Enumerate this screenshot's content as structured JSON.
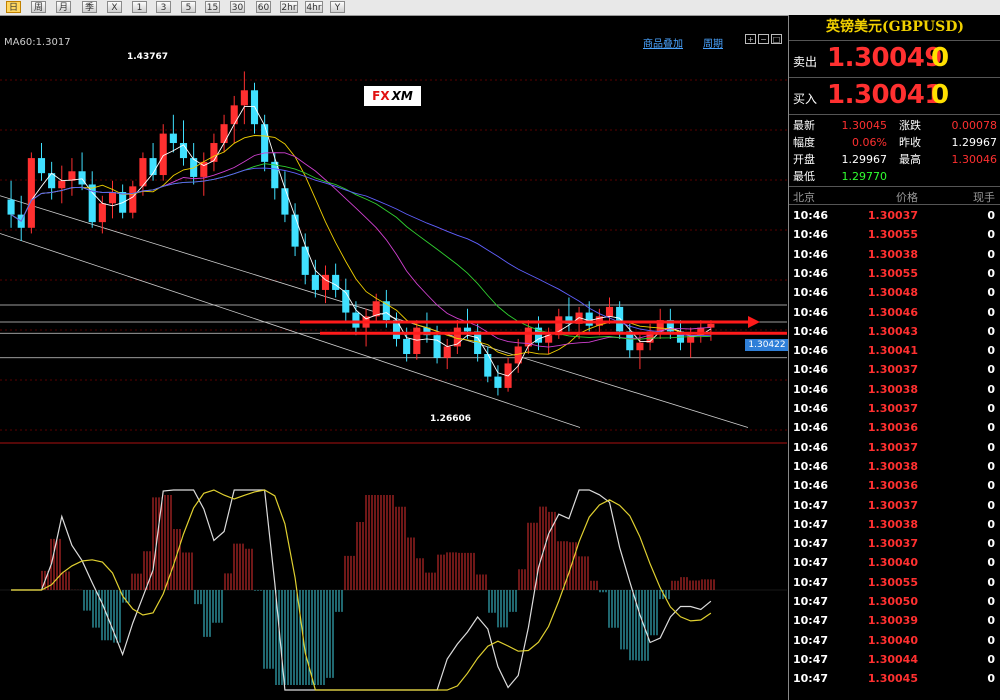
{
  "toolbar": {
    "buttons": [
      "日",
      "周",
      "月",
      "季",
      "X",
      "1",
      "3",
      "5",
      "15",
      "30",
      "60",
      "2hr",
      "4hr",
      "Y"
    ]
  },
  "chart_links": {
    "overlay": "商品叠加",
    "period": "周期"
  },
  "chart_data": {
    "type": "candlestick",
    "symbol": "GBPUSD",
    "ma_label": "MA60:1.3017",
    "high_annotation": "1.43767",
    "low_annotation": "1.26606",
    "current_price_tag": "1.30422",
    "price_range": [
      1.245,
      1.46
    ],
    "ohlc": [
      [
        1.37,
        1.38,
        1.355,
        1.362
      ],
      [
        1.362,
        1.372,
        1.348,
        1.355
      ],
      [
        1.355,
        1.395,
        1.352,
        1.392
      ],
      [
        1.392,
        1.4,
        1.38,
        1.384
      ],
      [
        1.384,
        1.39,
        1.37,
        1.376
      ],
      [
        1.376,
        1.388,
        1.368,
        1.38
      ],
      [
        1.38,
        1.392,
        1.372,
        1.385
      ],
      [
        1.385,
        1.395,
        1.375,
        1.378
      ],
      [
        1.378,
        1.385,
        1.355,
        1.358
      ],
      [
        1.358,
        1.372,
        1.352,
        1.368
      ],
      [
        1.368,
        1.38,
        1.36,
        1.374
      ],
      [
        1.374,
        1.378,
        1.36,
        1.363
      ],
      [
        1.363,
        1.38,
        1.36,
        1.377
      ],
      [
        1.377,
        1.395,
        1.372,
        1.392
      ],
      [
        1.392,
        1.4,
        1.38,
        1.383
      ],
      [
        1.383,
        1.41,
        1.38,
        1.405
      ],
      [
        1.405,
        1.415,
        1.395,
        1.4
      ],
      [
        1.4,
        1.412,
        1.388,
        1.392
      ],
      [
        1.392,
        1.4,
        1.378,
        1.382
      ],
      [
        1.382,
        1.395,
        1.372,
        1.39
      ],
      [
        1.39,
        1.405,
        1.385,
        1.4
      ],
      [
        1.4,
        1.415,
        1.395,
        1.41
      ],
      [
        1.41,
        1.425,
        1.4,
        1.42
      ],
      [
        1.42,
        1.438,
        1.41,
        1.428
      ],
      [
        1.428,
        1.432,
        1.405,
        1.41
      ],
      [
        1.41,
        1.415,
        1.385,
        1.39
      ],
      [
        1.39,
        1.395,
        1.37,
        1.376
      ],
      [
        1.376,
        1.385,
        1.358,
        1.362
      ],
      [
        1.362,
        1.368,
        1.34,
        1.345
      ],
      [
        1.345,
        1.352,
        1.325,
        1.33
      ],
      [
        1.33,
        1.338,
        1.318,
        1.322
      ],
      [
        1.322,
        1.335,
        1.315,
        1.33
      ],
      [
        1.33,
        1.336,
        1.318,
        1.322
      ],
      [
        1.322,
        1.328,
        1.305,
        1.31
      ],
      [
        1.31,
        1.316,
        1.298,
        1.302
      ],
      [
        1.302,
        1.312,
        1.292,
        1.308
      ],
      [
        1.308,
        1.32,
        1.305,
        1.316
      ],
      [
        1.316,
        1.322,
        1.302,
        1.306
      ],
      [
        1.306,
        1.31,
        1.292,
        1.296
      ],
      [
        1.296,
        1.302,
        1.284,
        1.288
      ],
      [
        1.288,
        1.306,
        1.285,
        1.302
      ],
      [
        1.302,
        1.31,
        1.294,
        1.298
      ],
      [
        1.298,
        1.303,
        1.283,
        1.286
      ],
      [
        1.286,
        1.296,
        1.28,
        1.292
      ],
      [
        1.292,
        1.306,
        1.288,
        1.302
      ],
      [
        1.302,
        1.312,
        1.296,
        1.3
      ],
      [
        1.3,
        1.304,
        1.284,
        1.288
      ],
      [
        1.288,
        1.292,
        1.273,
        1.276
      ],
      [
        1.276,
        1.282,
        1.266,
        1.27
      ],
      [
        1.27,
        1.286,
        1.268,
        1.283
      ],
      [
        1.283,
        1.296,
        1.278,
        1.292
      ],
      [
        1.292,
        1.306,
        1.288,
        1.302
      ],
      [
        1.302,
        1.308,
        1.29,
        1.294
      ],
      [
        1.294,
        1.302,
        1.288,
        1.298
      ],
      [
        1.298,
        1.312,
        1.296,
        1.308
      ],
      [
        1.308,
        1.318,
        1.3,
        1.304
      ],
      [
        1.304,
        1.313,
        1.296,
        1.31
      ],
      [
        1.31,
        1.316,
        1.3,
        1.303
      ],
      [
        1.303,
        1.312,
        1.298,
        1.308
      ],
      [
        1.308,
        1.318,
        1.304,
        1.313
      ],
      [
        1.313,
        1.316,
        1.296,
        1.3
      ],
      [
        1.3,
        1.304,
        1.286,
        1.29
      ],
      [
        1.29,
        1.298,
        1.28,
        1.294
      ],
      [
        1.294,
        1.304,
        1.29,
        1.3
      ],
      [
        1.3,
        1.312,
        1.296,
        1.306
      ],
      [
        1.306,
        1.312,
        1.296,
        1.3
      ],
      [
        1.3,
        1.306,
        1.29,
        1.294
      ],
      [
        1.294,
        1.302,
        1.286,
        1.298
      ],
      [
        1.298,
        1.306,
        1.294,
        1.302
      ],
      [
        1.302,
        1.306,
        1.295,
        1.304
      ]
    ],
    "horizontal_levels": [
      1.314,
      1.305,
      1.299,
      1.286
    ]
  },
  "panel": {
    "title": "英镑美元(GBPUSD)",
    "sell_label": "卖出",
    "sell_price": "1.30049",
    "sell_pip": "0",
    "buy_label": "买入",
    "buy_price": "1.30041",
    "buy_pip": "0",
    "stats": [
      {
        "label": "最新",
        "value": "1.30045",
        "color": "#ff3030"
      },
      {
        "label": "涨跌",
        "value": "0.00078",
        "color": "#ff3030"
      },
      {
        "label": "幅度",
        "value": "0.06%",
        "color": "#ff3030"
      },
      {
        "label": "昨收",
        "value": "1.29967",
        "color": "#ffffff"
      },
      {
        "label": "开盘",
        "value": "1.29967",
        "color": "#ffffff"
      },
      {
        "label": "最高",
        "value": "1.30046",
        "color": "#ff3030"
      },
      {
        "label": "最低",
        "value": "1.29770",
        "color": "#30ff30"
      }
    ],
    "tick_header": {
      "time": "北京",
      "price": "价格",
      "vol": "现手"
    },
    "ticks": [
      {
        "time": "10:46",
        "price": "1.30037",
        "vol": "0"
      },
      {
        "time": "10:46",
        "price": "1.30055",
        "vol": "0"
      },
      {
        "time": "10:46",
        "price": "1.30038",
        "vol": "0"
      },
      {
        "time": "10:46",
        "price": "1.30055",
        "vol": "0"
      },
      {
        "time": "10:46",
        "price": "1.30048",
        "vol": "0"
      },
      {
        "time": "10:46",
        "price": "1.30046",
        "vol": "0"
      },
      {
        "time": "10:46",
        "price": "1.30043",
        "vol": "0"
      },
      {
        "time": "10:46",
        "price": "1.30041",
        "vol": "0"
      },
      {
        "time": "10:46",
        "price": "1.30037",
        "vol": "0"
      },
      {
        "time": "10:46",
        "price": "1.30038",
        "vol": "0"
      },
      {
        "time": "10:46",
        "price": "1.30037",
        "vol": "0"
      },
      {
        "time": "10:46",
        "price": "1.30036",
        "vol": "0"
      },
      {
        "time": "10:46",
        "price": "1.30037",
        "vol": "0"
      },
      {
        "time": "10:46",
        "price": "1.30038",
        "vol": "0"
      },
      {
        "time": "10:46",
        "price": "1.30036",
        "vol": "0"
      },
      {
        "time": "10:47",
        "price": "1.30037",
        "vol": "0"
      },
      {
        "time": "10:47",
        "price": "1.30038",
        "vol": "0"
      },
      {
        "time": "10:47",
        "price": "1.30037",
        "vol": "0"
      },
      {
        "time": "10:47",
        "price": "1.30040",
        "vol": "0"
      },
      {
        "time": "10:47",
        "price": "1.30055",
        "vol": "0"
      },
      {
        "time": "10:47",
        "price": "1.30050",
        "vol": "0"
      },
      {
        "time": "10:47",
        "price": "1.30039",
        "vol": "0"
      },
      {
        "time": "10:47",
        "price": "1.30040",
        "vol": "0"
      },
      {
        "time": "10:47",
        "price": "1.30044",
        "vol": "0"
      },
      {
        "time": "10:47",
        "price": "1.30045",
        "vol": "0"
      }
    ]
  },
  "colors": {
    "up": "#ff3030",
    "down": "#40e0ff",
    "accent": "#f0d000"
  },
  "logo": {
    "mark": "FX",
    "text": "XM"
  }
}
